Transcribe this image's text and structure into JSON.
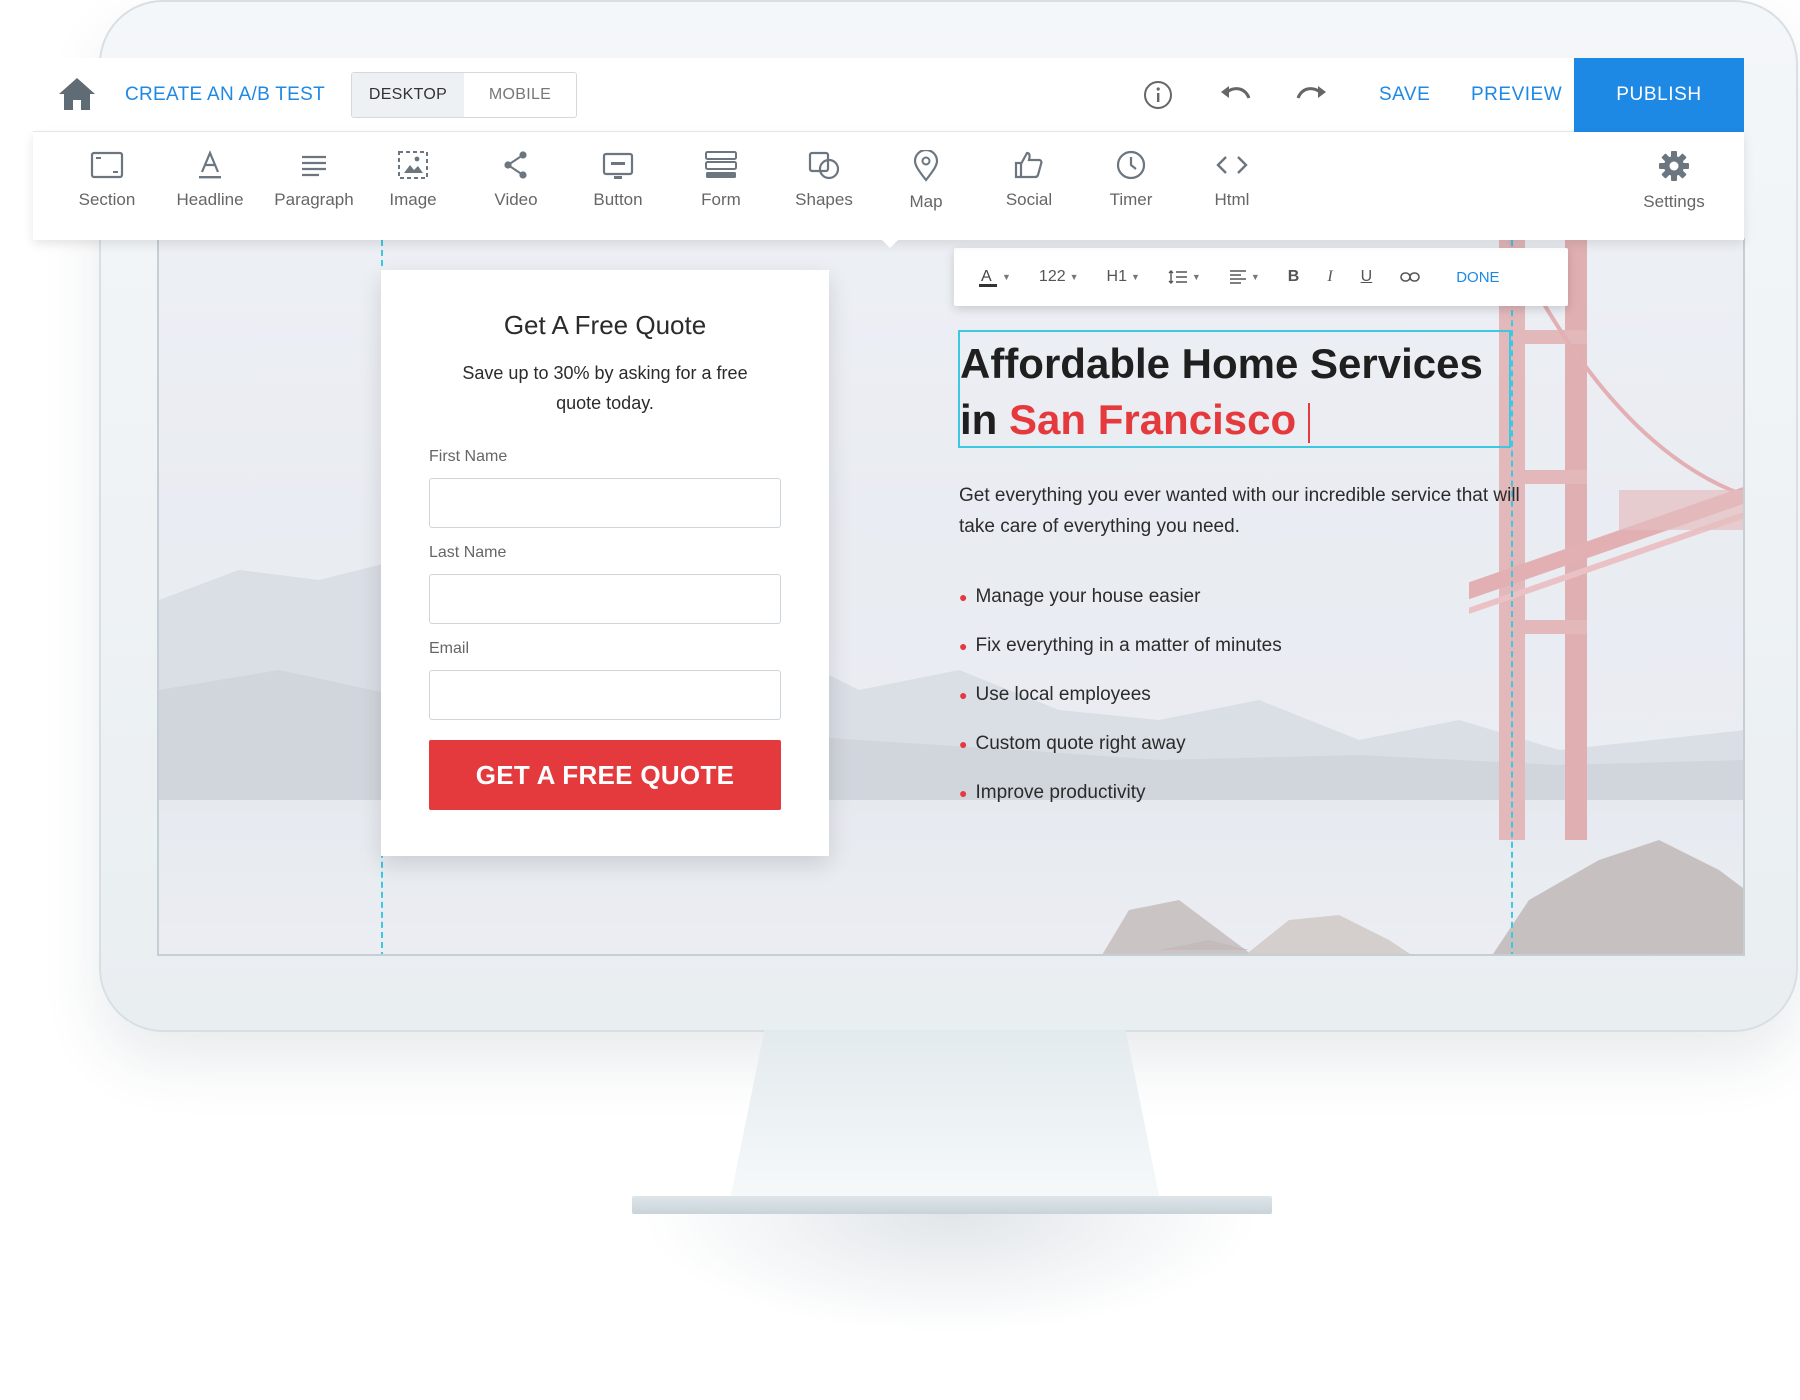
{
  "topbar": {
    "create_ab_test": "CREATE AN A/B TEST",
    "view_toggle": {
      "desktop": "DESKTOP",
      "mobile": "MOBILE",
      "active": "desktop"
    },
    "info_icon": "info-icon",
    "undo_icon": "undo-icon",
    "redo_icon": "redo-icon",
    "save": "SAVE",
    "preview": "PREVIEW",
    "publish": "PUBLISH",
    "accent_color": "#1e88e5"
  },
  "toolbar": {
    "items": [
      {
        "label": "Section",
        "icon": "section-icon"
      },
      {
        "label": "Headline",
        "icon": "headline-icon"
      },
      {
        "label": "Paragraph",
        "icon": "paragraph-icon"
      },
      {
        "label": "Image",
        "icon": "image-icon"
      },
      {
        "label": "Video",
        "icon": "share-icon"
      },
      {
        "label": "Button",
        "icon": "button-icon"
      },
      {
        "label": "Form",
        "icon": "form-icon"
      },
      {
        "label": "Shapes",
        "icon": "shapes-icon"
      },
      {
        "label": "Map",
        "icon": "map-pin-icon"
      },
      {
        "label": "Social",
        "icon": "thumbs-up-icon"
      },
      {
        "label": "Timer",
        "icon": "clock-icon"
      },
      {
        "label": "Html",
        "icon": "code-icon"
      }
    ],
    "settings": {
      "label": "Settings",
      "icon": "gear-icon"
    }
  },
  "text_toolbar": {
    "font_color_icon": "font-color-icon",
    "font_size": "122",
    "heading_level": "H1",
    "line_height_icon": "line-height-icon",
    "align_icon": "align-left-icon",
    "bold": "B",
    "italic": "I",
    "underline": "U",
    "link_icon": "link-icon",
    "done": "DONE"
  },
  "form_card": {
    "title": "Get A Free Quote",
    "subtitle": "Save up to 30% by asking for a free quote today.",
    "fields": [
      {
        "label": "First Name",
        "value": ""
      },
      {
        "label": "Last Name",
        "value": ""
      },
      {
        "label": "Email",
        "value": ""
      }
    ],
    "cta": "GET A FREE QUOTE",
    "cta_color": "#e53a3d"
  },
  "hero": {
    "headline_part1": "Affordable Home Services",
    "headline_part2_prefix": "in ",
    "headline_part2_highlight": "San Francisco",
    "highlight_color": "#e53a3d",
    "body": "Get everything you ever wanted with our incredible service that will take care of everything you need.",
    "bullets": [
      "Manage your house easier",
      "Fix everything in a matter of minutes",
      "Use local employees",
      "Custom quote right away",
      "Improve productivity"
    ]
  }
}
